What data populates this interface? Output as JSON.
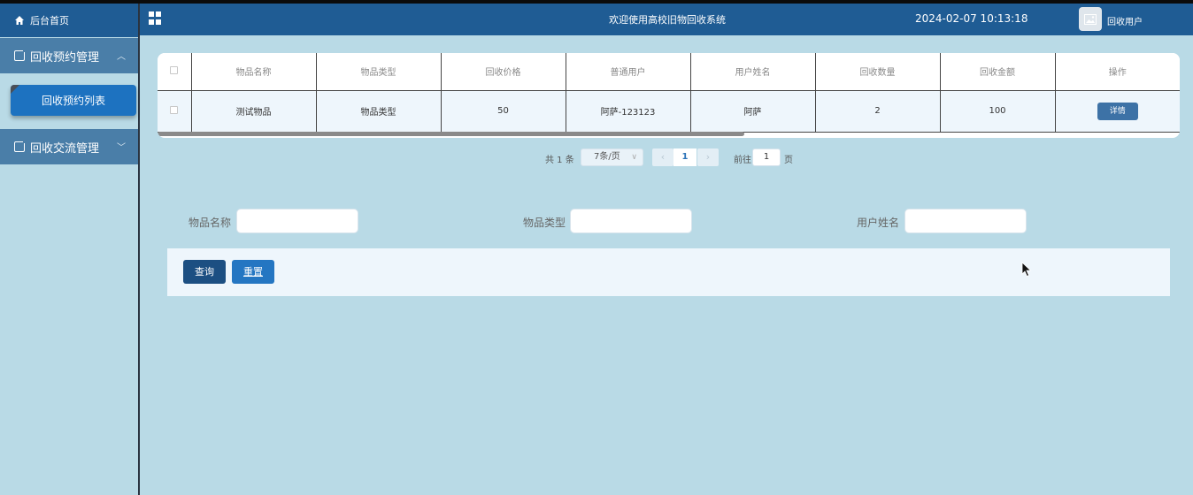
{
  "sidebar": {
    "home": "后台首页",
    "groups": [
      {
        "label": "回收预约管理",
        "expanded": true,
        "items": [
          "回收预约列表"
        ]
      },
      {
        "label": "回收交流管理",
        "expanded": false
      }
    ]
  },
  "header": {
    "title": "欢迎使用高校旧物回收系统",
    "datetime": "2024-02-07 10:13:18",
    "user": "回收用户"
  },
  "table": {
    "columns": [
      "物品名称",
      "物品类型",
      "回收价格",
      "普通用户",
      "用户姓名",
      "回收数量",
      "回收金额",
      "操作"
    ],
    "rows": [
      {
        "name": "测试物品",
        "type": "物品类型",
        "price": "50",
        "user": "阿萨-123123",
        "username": "阿萨",
        "qty": "2",
        "amount": "100",
        "action": "详情"
      }
    ]
  },
  "pagination": {
    "total": "共 1 条",
    "page_size": "7条/页",
    "prev": "‹",
    "current": "1",
    "next": "›",
    "goto": "前往",
    "goto_value": "1",
    "page_unit": "页"
  },
  "search": {
    "fields": [
      {
        "label": "物品名称",
        "value": ""
      },
      {
        "label": "物品类型",
        "value": ""
      },
      {
        "label": "用户姓名",
        "value": ""
      }
    ],
    "query_label": "查询",
    "reset_label": "重置"
  }
}
